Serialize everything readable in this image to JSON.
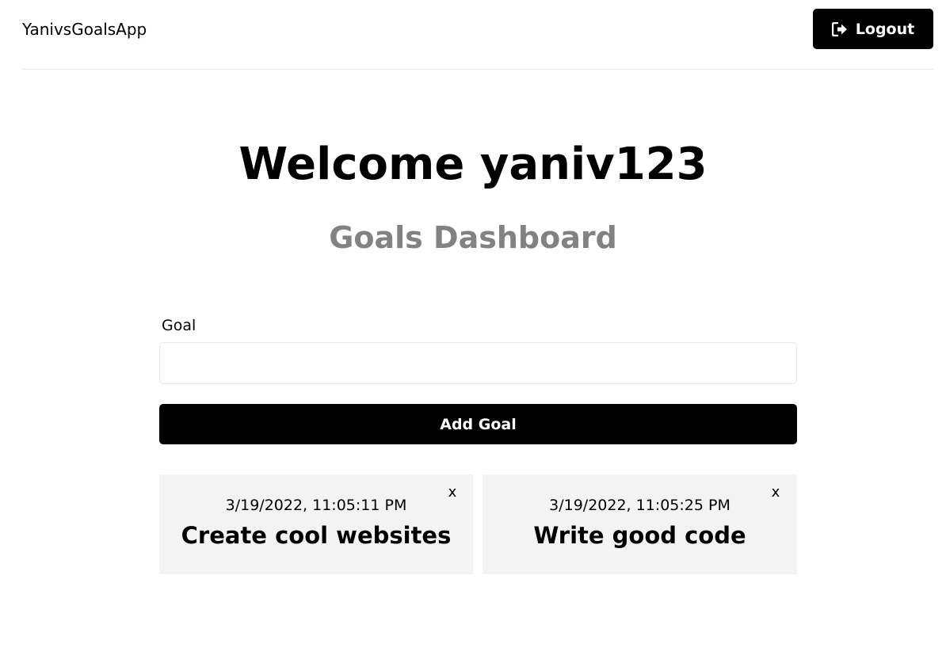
{
  "header": {
    "brand": "YanivsGoalsApp",
    "logout_label": "Logout",
    "logout_icon": "sign-out-icon"
  },
  "dashboard": {
    "welcome": "Welcome yaniv123",
    "subtitle": "Goals Dashboard"
  },
  "form": {
    "goal_label": "Goal",
    "goal_value": "",
    "submit_label": "Add Goal"
  },
  "goals": [
    {
      "date": "3/19/2022, 11:05:11 PM",
      "text": "Create cool websites",
      "close_label": "x"
    },
    {
      "date": "3/19/2022, 11:05:25 PM",
      "text": "Write good code",
      "close_label": "x"
    }
  ],
  "colors": {
    "primary": "#000000",
    "subtitle": "#828282",
    "card_bg": "#f3f3f3",
    "divider": "#e6e6e6"
  }
}
